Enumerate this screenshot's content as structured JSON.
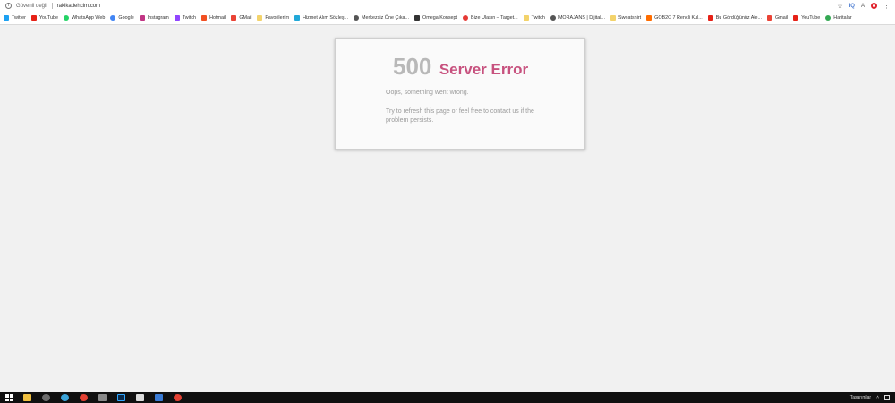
{
  "address_bar": {
    "security_label": "Güvenli değil",
    "url": "rakikadehcim.com"
  },
  "bookmarks": [
    {
      "label": "Twitter",
      "icon": "twitter-icon",
      "color": "#1da1f2"
    },
    {
      "label": "YouTube",
      "icon": "youtube-icon",
      "color": "#e62117"
    },
    {
      "label": "WhatsApp Web",
      "icon": "whatsapp-icon",
      "color": "#25d366"
    },
    {
      "label": "Google",
      "icon": "google-icon",
      "color": "#4285f4"
    },
    {
      "label": "Instagram",
      "icon": "instagram-icon",
      "color": "#c13584"
    },
    {
      "label": "Twitch",
      "icon": "twitch-icon",
      "color": "#9146ff"
    },
    {
      "label": "Hotmail",
      "icon": "microsoft-icon",
      "color": "#f25022"
    },
    {
      "label": "GMail",
      "icon": "gmail-icon",
      "color": "#ea4335"
    },
    {
      "label": "Favorilerim",
      "icon": "folder-icon",
      "color": "#f3d36b"
    },
    {
      "label": "Hizmet Alım Sözleş...",
      "icon": "w-icon",
      "color": "#21a8d8"
    },
    {
      "label": "Merkezsiz Öne Çıka...",
      "icon": "globe-icon",
      "color": "#555555"
    },
    {
      "label": "Omega Konsept",
      "icon": "omega-icon",
      "color": "#333333"
    },
    {
      "label": "Bize Ulaşın – Target...",
      "icon": "target-icon",
      "color": "#e53935"
    },
    {
      "label": "Twitch",
      "icon": "folder-icon",
      "color": "#f3d36b"
    },
    {
      "label": "MORAJANS | Dijital...",
      "icon": "globe-icon",
      "color": "#555555"
    },
    {
      "label": "Sweatshirt",
      "icon": "folder-icon",
      "color": "#f3d36b"
    },
    {
      "label": "GOB2C 7 Renkli Kul...",
      "icon": "gob-icon",
      "color": "#ff6d00"
    },
    {
      "label": "Bu Gördüğünüz Ale...",
      "icon": "youtube-icon",
      "color": "#e62117"
    },
    {
      "label": "Gmail",
      "icon": "gmail-icon",
      "color": "#ea4335"
    },
    {
      "label": "YouTube",
      "icon": "youtube-icon",
      "color": "#e62117"
    },
    {
      "label": "Haritalar",
      "icon": "maps-icon",
      "color": "#34a853"
    }
  ],
  "error": {
    "code": "500",
    "title": "Server Error",
    "message": "Oops, something went wrong.",
    "detail": "Try to refresh this page or feel free to contact us if the problem persists."
  },
  "taskbar": {
    "right_label": "Tasarımlar"
  }
}
